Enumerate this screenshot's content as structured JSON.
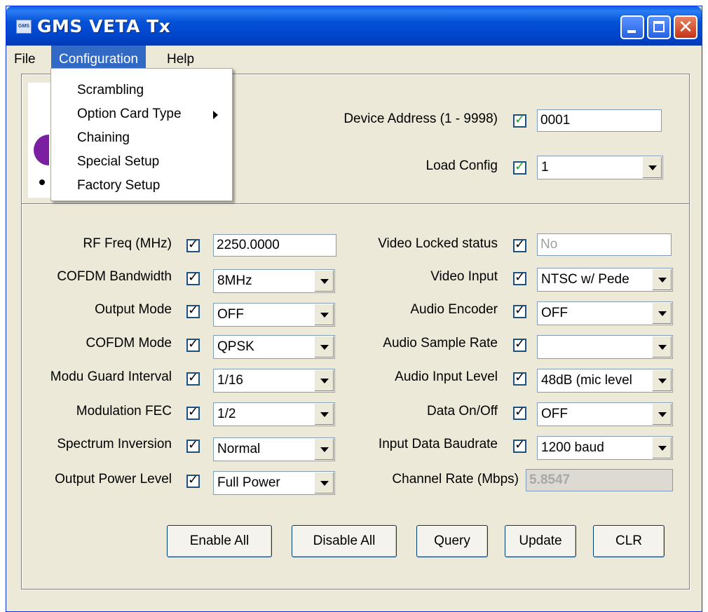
{
  "window": {
    "title": "GMS VETA Tx",
    "icon_label": "GMS"
  },
  "menubar": {
    "file": "File",
    "configuration": "Configuration",
    "help": "Help"
  },
  "config_menu": {
    "items": [
      "Scrambling",
      "Option Card Type",
      "Chaining",
      "Special Setup",
      "Factory Setup"
    ]
  },
  "device": {
    "address_label": "Device Address (1 - 9998)",
    "address_value": "0001",
    "load_config_label": "Load Config",
    "load_config_value": "1"
  },
  "left_fields": [
    {
      "label": "RF Freq (MHz)",
      "value": "2250.0000",
      "kind": "text"
    },
    {
      "label": "COFDM Bandwidth",
      "value": "8MHz",
      "kind": "select"
    },
    {
      "label": "Output Mode",
      "value": "OFF",
      "kind": "select"
    },
    {
      "label": "COFDM Mode",
      "value": "QPSK",
      "kind": "select"
    },
    {
      "label": "Modu Guard Interval",
      "value": "1/16",
      "kind": "select"
    },
    {
      "label": "Modulation FEC",
      "value": "1/2",
      "kind": "select"
    },
    {
      "label": "Spectrum Inversion",
      "value": "Normal",
      "kind": "select"
    },
    {
      "label": "Output Power Level",
      "value": "Full Power",
      "kind": "select"
    }
  ],
  "right_fields": [
    {
      "label": "Video Locked status",
      "value": "No",
      "kind": "text-disabled"
    },
    {
      "label": "Video Input",
      "value": "NTSC w/ Pede",
      "kind": "select"
    },
    {
      "label": "Audio Encoder",
      "value": "OFF",
      "kind": "select"
    },
    {
      "label": "Audio Sample Rate",
      "value": "",
      "kind": "select"
    },
    {
      "label": "Audio Input Level",
      "value": "48dB (mic level",
      "kind": "select"
    },
    {
      "label": "Data On/Off",
      "value": "OFF",
      "kind": "select"
    },
    {
      "label": "Input Data Baudrate",
      "value": "1200 baud",
      "kind": "select"
    },
    {
      "label": "Channel Rate (Mbps)",
      "value": "5.8547",
      "kind": "readonly"
    }
  ],
  "buttons": {
    "enable_all": "Enable All",
    "disable_all": "Disable All",
    "query": "Query",
    "update": "Update",
    "clr": "CLR"
  },
  "colors": {
    "title_bar": "#0451d8",
    "menu_highlight": "#316ac5",
    "check": "#21a121",
    "window_bg": "#ece9d8"
  }
}
